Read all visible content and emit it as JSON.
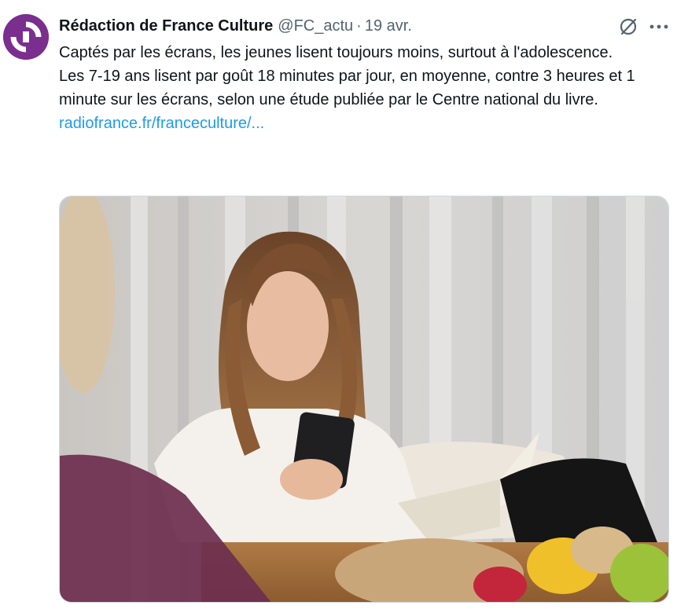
{
  "tweet": {
    "author_name": "Rédaction de France Culture",
    "handle": "@FC_actu",
    "separator": "·",
    "date": "19 avr.",
    "avatar_icon": "france-culture-logo",
    "text_line1": "Captés par les écrans, les jeunes lisent toujours moins, surtout à l'adolescence.",
    "text_line2": "Les 7-19 ans lisent par goût 18 minutes par jour, en moyenne, contre 3 heures et 1 minute sur les écrans, selon une étude publiée par le Centre national du livre.",
    "link_text": "radiofrance.fr/franceculture/...",
    "colors": {
      "link": "#1d9bf0",
      "secondary_text": "#536471",
      "avatar_bg": "#7a2e8e"
    }
  },
  "actions": {
    "grok_icon": "grok-slash-circle-icon",
    "more_icon": "more-horizontal-icon"
  },
  "media": {
    "kind": "photo"
  }
}
